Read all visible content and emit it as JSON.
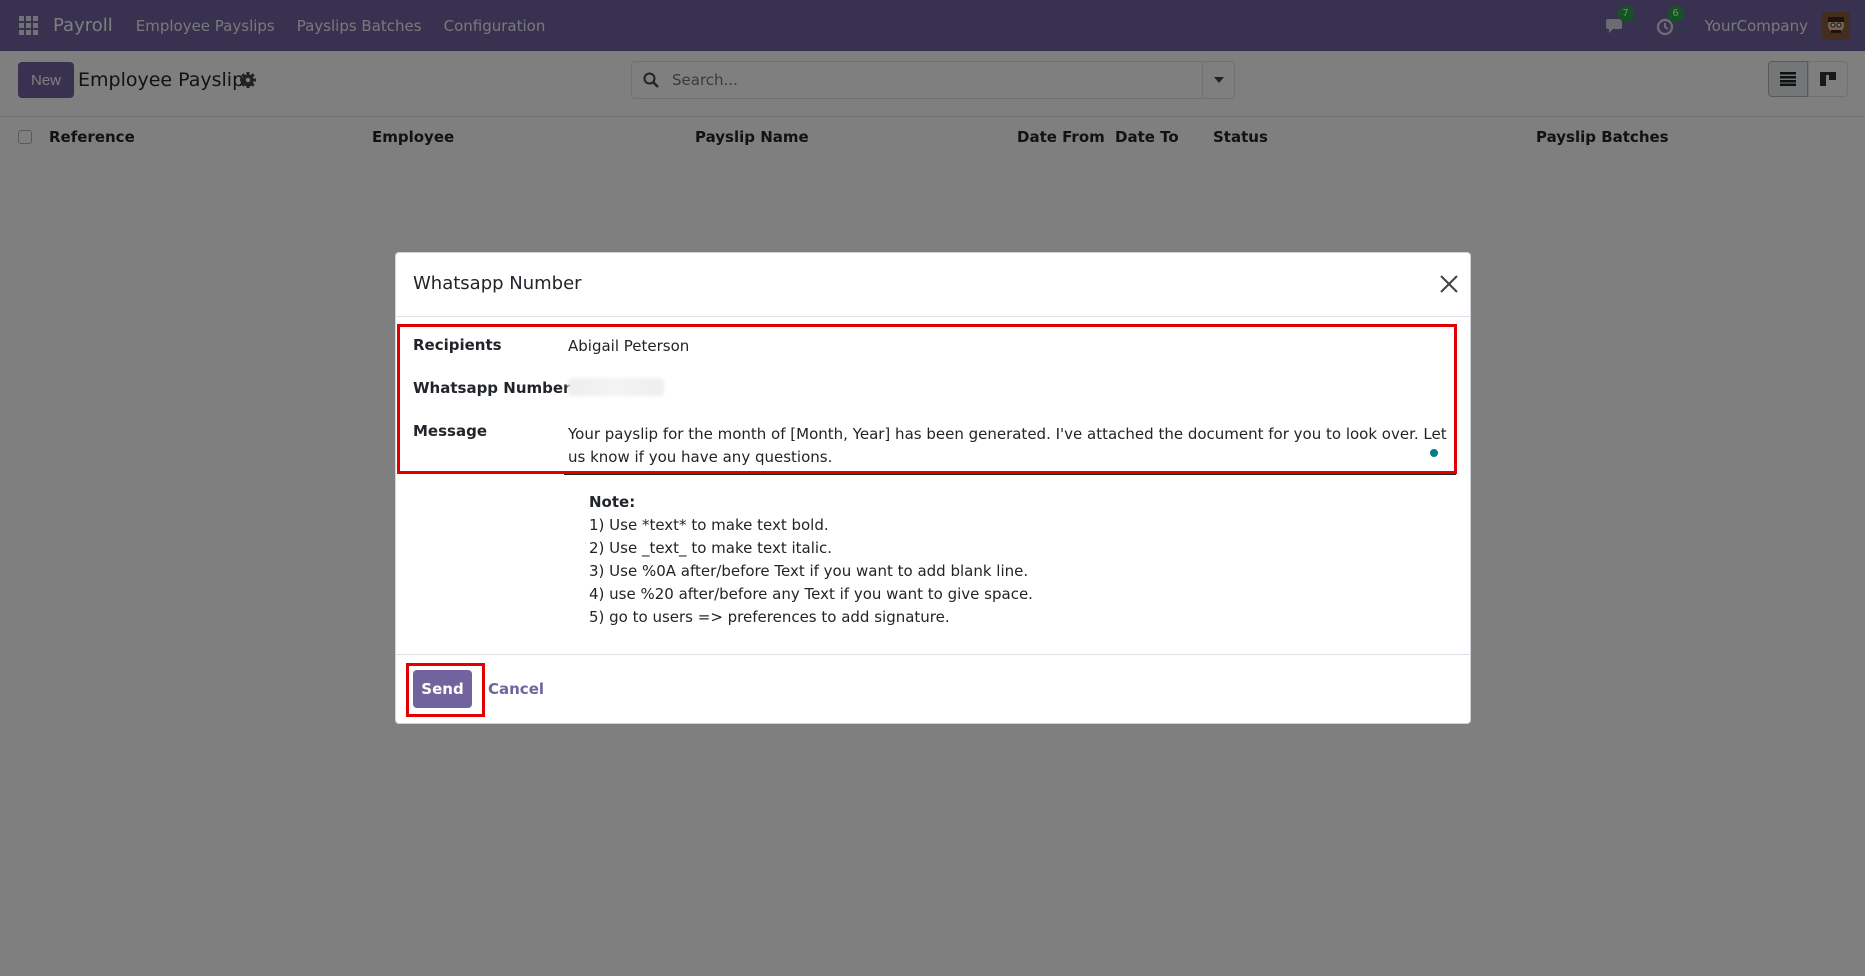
{
  "navbar": {
    "app_name": "Payroll",
    "menu": [
      "Employee Payslips",
      "Payslips Batches",
      "Configuration"
    ],
    "messages_count": "7",
    "activities_count": "6",
    "company": "YourCompany"
  },
  "control_panel": {
    "new_label": "New",
    "title": "Employee Payslips",
    "search_placeholder": "Search..."
  },
  "list": {
    "columns": [
      "Reference",
      "Employee",
      "Payslip Name",
      "Date From",
      "Date To",
      "Status",
      "Payslip Batches"
    ]
  },
  "dialog": {
    "title": "Whatsapp Number",
    "fields": {
      "recipients_label": "Recipients",
      "recipients_value": "Abigail Peterson",
      "number_label": "Whatsapp Number",
      "message_label": "Message",
      "message_value": "Your payslip for the month of [Month, Year] has been generated. I've attached the document for you to look over. Let us know if you have any questions."
    },
    "note": {
      "title": "Note:",
      "lines": [
        "1) Use *text* to make text bold.",
        "2) Use _text_ to make text italic.",
        "3) Use %0A after/before Text if you want to add blank line.",
        "4) use %20 after/before any Text if you want to give space.",
        "5) go to users => preferences to add signature."
      ]
    },
    "send_label": "Send",
    "cancel_label": "Cancel"
  },
  "colors": {
    "brand": "#71639e",
    "highlight": "#e00000",
    "badge": "#28a745"
  }
}
